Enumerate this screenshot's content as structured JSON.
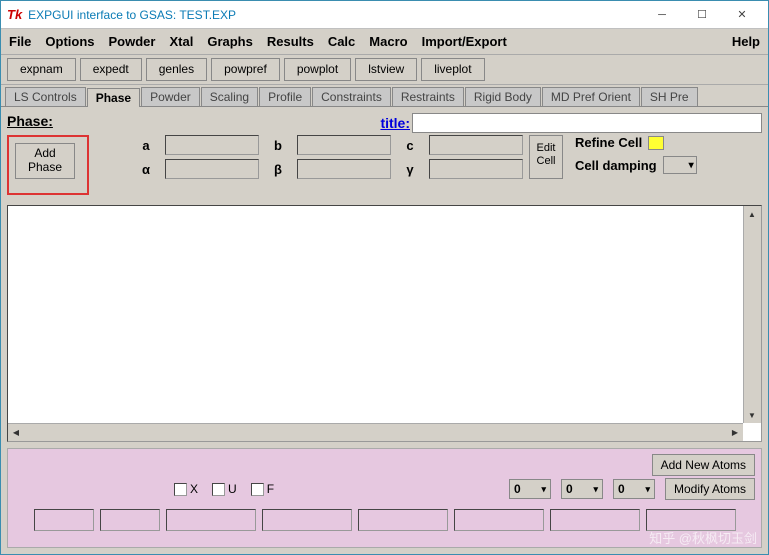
{
  "titlebar": {
    "icon": "Tk",
    "title": "EXPGUI interface to GSAS: TEST.EXP"
  },
  "menus": [
    "File",
    "Options",
    "Powder",
    "Xtal",
    "Graphs",
    "Results",
    "Calc",
    "Macro",
    "Import/Export"
  ],
  "help_menu": "Help",
  "toolbar": [
    "expnam",
    "expedt",
    "genles",
    "powpref",
    "powplot",
    "lstview",
    "liveplot"
  ],
  "tabs": [
    "LS Controls",
    "Phase",
    "Powder",
    "Scaling",
    "Profile",
    "Constraints",
    "Restraints",
    "Rigid Body",
    "MD Pref Orient",
    "SH Pre"
  ],
  "active_tab": 1,
  "phase": {
    "section_label": "Phase:",
    "add_btn": "Add\nPhase",
    "title_label": "title:",
    "title_value": "",
    "lattice_labels": {
      "a": "a",
      "b": "b",
      "c": "c",
      "al": "α",
      "be": "β",
      "ga": "γ"
    },
    "edit_cell": "Edit\nCell",
    "refine_cell": "Refine Cell",
    "cell_damping": "Cell damping"
  },
  "bottom": {
    "add_new": "Add New Atoms",
    "modify": "Modify Atoms",
    "checks": [
      "X",
      "U",
      "F"
    ],
    "num": "0"
  },
  "watermark": "知乎 @秋枫切玉剑"
}
